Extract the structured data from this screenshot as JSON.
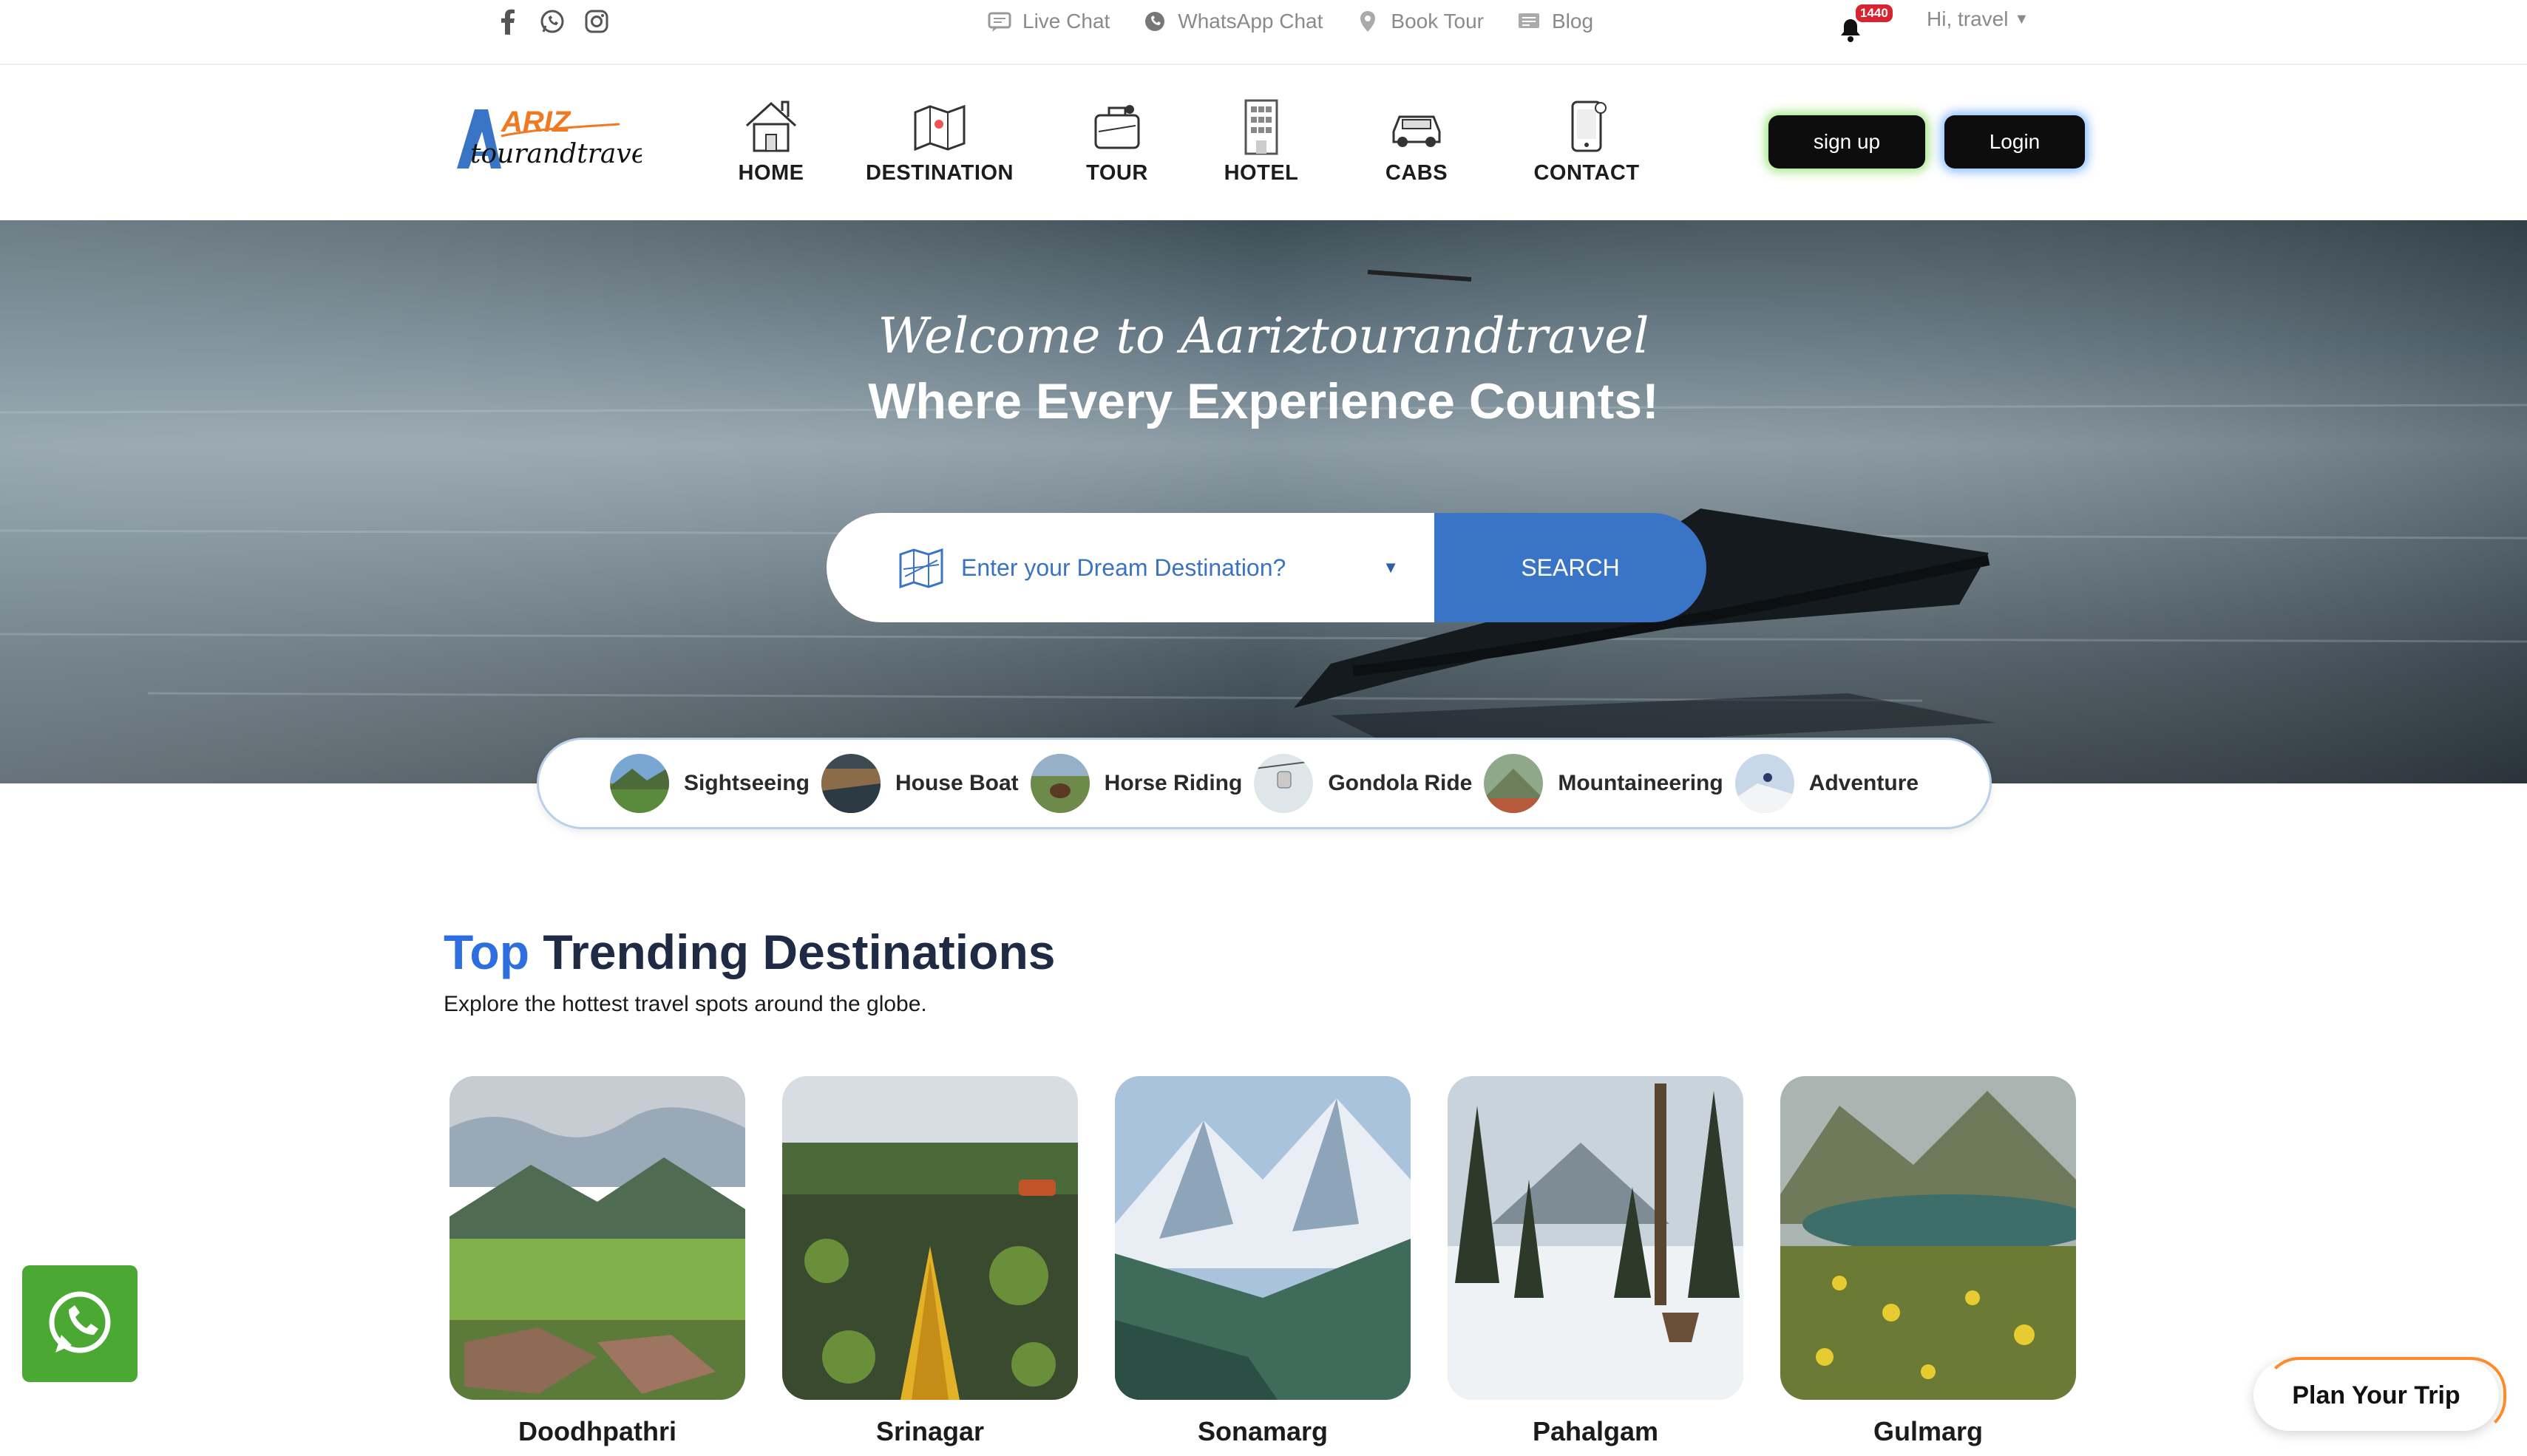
{
  "topbar": {
    "social_icons": [
      "facebook-icon",
      "whatsapp-icon",
      "instagram-icon"
    ],
    "links": [
      {
        "label": "Live Chat",
        "icon": "chat-bubble-icon"
      },
      {
        "label": "WhatsApp Chat",
        "icon": "whatsapp-icon"
      },
      {
        "label": "Book Tour",
        "icon": "map-pin-icon"
      },
      {
        "label": "Blog",
        "icon": "blog-icon"
      }
    ],
    "notification_count": "1440",
    "greeting": "Hi, travel"
  },
  "logo": {
    "top": "ARIZ",
    "bottom": "tourandtravel"
  },
  "nav": [
    {
      "label": "HOME",
      "icon": "house-icon"
    },
    {
      "label": "DESTINATION",
      "icon": "map-icon"
    },
    {
      "label": "TOUR",
      "icon": "suitcase-icon"
    },
    {
      "label": "HOTEL",
      "icon": "building-icon"
    },
    {
      "label": "CABS",
      "icon": "car-icon"
    },
    {
      "label": "CONTACT",
      "icon": "phone-icon"
    }
  ],
  "auth": {
    "signup": "sign up",
    "login": "Login"
  },
  "hero": {
    "welcome": "Welcome to Aariztourandtravel",
    "headline": "Where Every Experience Counts!",
    "search_placeholder": "Enter your Dream Destination?",
    "search_button": "SEARCH"
  },
  "activities": [
    "Sightseeing",
    "House Boat",
    "Horse Riding",
    "Gondola Ride",
    "Mountaineering",
    "Adventure"
  ],
  "trending": {
    "title_highlight": "Top",
    "title_rest": " Trending Destinations",
    "subtitle": "Explore the hottest travel spots around the globe.",
    "destinations": [
      "Doodhpathri",
      "Srinagar",
      "Sonamarg",
      "Pahalgam",
      "Gulmarg"
    ]
  },
  "floating": {
    "plan_trip": "Plan Your Trip"
  },
  "colors": {
    "accent": "#3a74c6",
    "highlight": "#2e6fe0",
    "whatsapp": "#4aa833",
    "dark_button": "#0d0d0d"
  }
}
